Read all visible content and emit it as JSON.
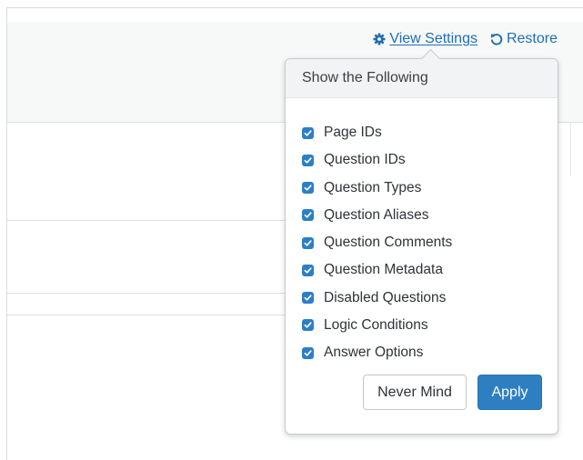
{
  "toolbar": {
    "view_settings_label": "View Settings",
    "restore_label": "Restore"
  },
  "popover": {
    "title": "Show the Following",
    "options": [
      {
        "label": "Page IDs",
        "checked": true
      },
      {
        "label": "Question IDs",
        "checked": true
      },
      {
        "label": "Question Types",
        "checked": true
      },
      {
        "label": "Question Aliases",
        "checked": true
      },
      {
        "label": "Question Comments",
        "checked": true
      },
      {
        "label": "Question Metadata",
        "checked": true
      },
      {
        "label": "Disabled Questions",
        "checked": true
      },
      {
        "label": "Logic Conditions",
        "checked": true
      },
      {
        "label": "Answer Options",
        "checked": true
      }
    ],
    "cancel_label": "Never Mind",
    "apply_label": "Apply"
  },
  "colors": {
    "accent": "#2e7fc2",
    "link": "#1f6fb2",
    "header_bg": "#f2f3f4"
  },
  "icons": {
    "view_settings": "gear-icon",
    "restore": "undo-icon",
    "checkbox": "check-icon"
  }
}
